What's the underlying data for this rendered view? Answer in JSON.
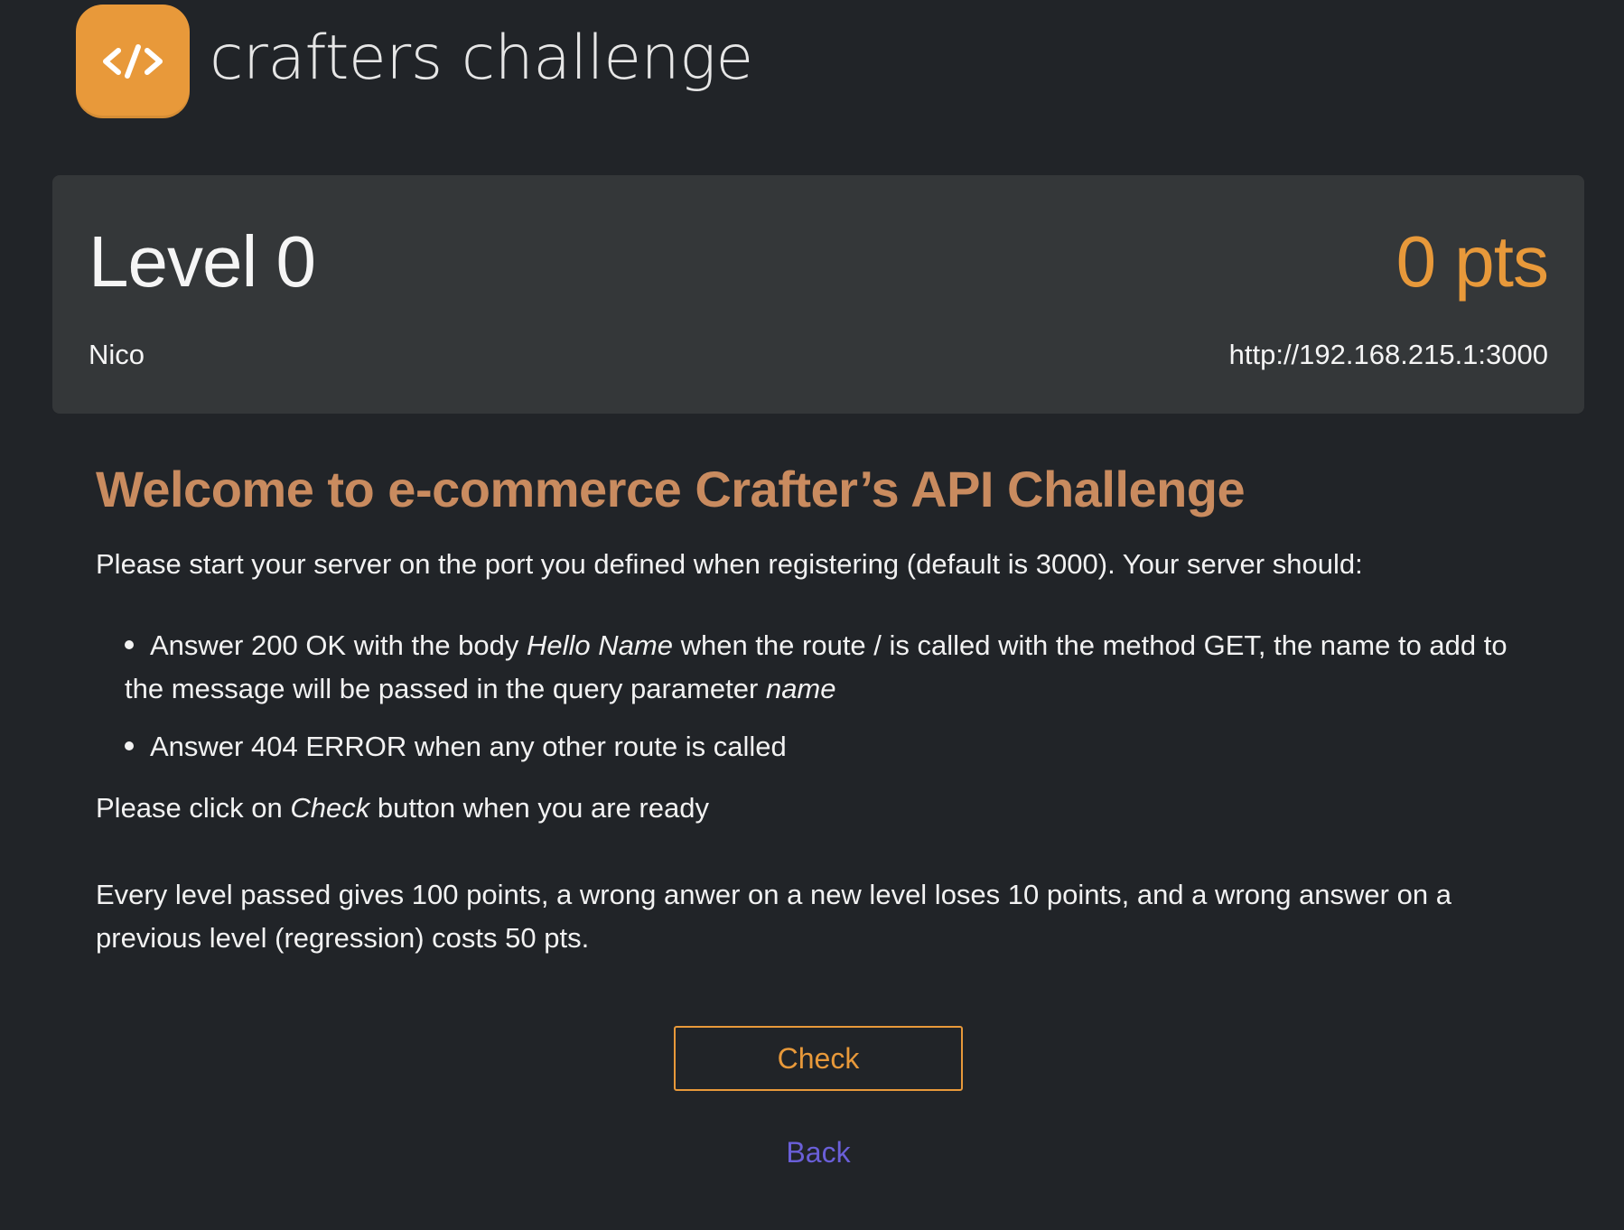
{
  "header": {
    "logo_glyph": "</>",
    "brand_name": "crafters challenge",
    "logo_color": "#e8993a"
  },
  "level_card": {
    "level_title": "Level 0",
    "points": "0 pts",
    "player_name": "Nico",
    "server_url": "http://192.168.215.1:3000"
  },
  "content": {
    "title": "Welcome to e-commerce Crafter’s API Challenge",
    "intro": "Please start your server on the port you defined when registering (default is 3000). Your server should:",
    "requirements": [
      {
        "part1": "Answer 200 OK with the body ",
        "em1": "Hello Name",
        "part2": " when the route / is called with the method GET, the name to add to the message will be passed in the query parameter ",
        "em2": "name"
      },
      {
        "text": "Answer 404 ERROR when any other route is called"
      }
    ],
    "ready_prefix": "Please click on ",
    "ready_em": "Check",
    "ready_suffix": " button when you are ready",
    "points_rules": "Every level passed gives 100 points, a wrong anwer on a new level loses 10 points, and a wrong answer on a previous level (regression) costs 50 pts."
  },
  "actions": {
    "check_label": "Check",
    "back_label": "Back"
  },
  "colors": {
    "background": "#212428",
    "card": "#343739",
    "accent": "#e8993a",
    "title": "#c98b5f",
    "link": "#6a5fd8"
  }
}
